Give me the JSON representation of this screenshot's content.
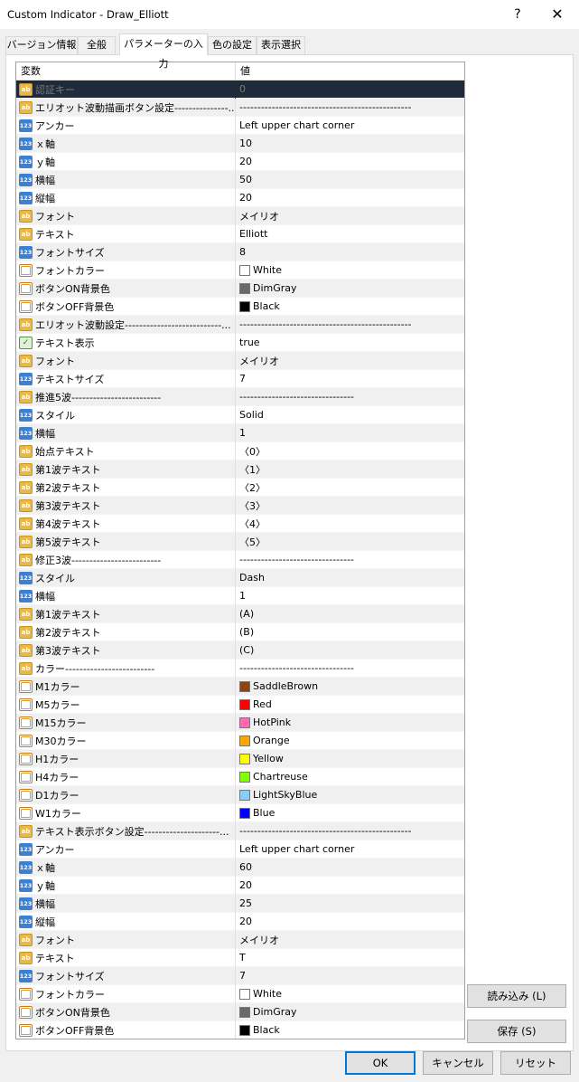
{
  "window": {
    "title": "Custom Indicator - Draw_Elliott",
    "help_label": "?",
    "close_label": "✕"
  },
  "tabs": [
    {
      "label": "バージョン情報"
    },
    {
      "label": "全般"
    },
    {
      "label": "パラメーターの入力"
    },
    {
      "label": "色の設定"
    },
    {
      "label": "表示選択"
    }
  ],
  "grid": {
    "headers": {
      "variable": "変数",
      "value": "値"
    },
    "rows": [
      {
        "icon": "str",
        "name": "認証キー",
        "value": "0"
      },
      {
        "icon": "str",
        "name": "エリオット波動描画ボタン設定---------------...",
        "value": "------------------------------------------------"
      },
      {
        "icon": "int",
        "name": "アンカー",
        "value": "Left upper chart corner"
      },
      {
        "icon": "int",
        "name": "ｘ軸",
        "value": "10"
      },
      {
        "icon": "int",
        "name": "ｙ軸",
        "value": "20"
      },
      {
        "icon": "int",
        "name": "横幅",
        "value": "50"
      },
      {
        "icon": "int",
        "name": "縦幅",
        "value": "20"
      },
      {
        "icon": "str",
        "name": "フォント",
        "value": "メイリオ"
      },
      {
        "icon": "str",
        "name": "テキスト",
        "value": "Elliott"
      },
      {
        "icon": "int",
        "name": "フォントサイズ",
        "value": "8"
      },
      {
        "icon": "color",
        "name": "フォントカラー",
        "value": "White",
        "swatch": "#ffffff"
      },
      {
        "icon": "color",
        "name": "ボタンON背景色",
        "value": "DimGray",
        "swatch": "#696969"
      },
      {
        "icon": "color",
        "name": "ボタンOFF背景色",
        "value": "Black",
        "swatch": "#000000"
      },
      {
        "icon": "str",
        "name": "エリオット波動設定---------------------------...",
        "value": "------------------------------------------------"
      },
      {
        "icon": "bool",
        "name": "テキスト表示",
        "value": "true"
      },
      {
        "icon": "str",
        "name": "フォント",
        "value": "メイリオ"
      },
      {
        "icon": "int",
        "name": "テキストサイズ",
        "value": "7"
      },
      {
        "icon": "str",
        "name": "推進5波-------------------------",
        "value": "--------------------------------"
      },
      {
        "icon": "int",
        "name": "スタイル",
        "value": "Solid"
      },
      {
        "icon": "int",
        "name": "横幅",
        "value": "1"
      },
      {
        "icon": "str",
        "name": "始点テキスト",
        "value": "〈0〉"
      },
      {
        "icon": "str",
        "name": "第1波テキスト",
        "value": "〈1〉"
      },
      {
        "icon": "str",
        "name": "第2波テキスト",
        "value": "〈2〉"
      },
      {
        "icon": "str",
        "name": "第3波テキスト",
        "value": "〈3〉"
      },
      {
        "icon": "str",
        "name": "第4波テキスト",
        "value": "〈4〉"
      },
      {
        "icon": "str",
        "name": "第5波テキスト",
        "value": "〈5〉"
      },
      {
        "icon": "str",
        "name": "修正3波-------------------------",
        "value": "--------------------------------"
      },
      {
        "icon": "int",
        "name": "スタイル",
        "value": "Dash"
      },
      {
        "icon": "int",
        "name": "横幅",
        "value": "1"
      },
      {
        "icon": "str",
        "name": "第1波テキスト",
        "value": "(A)"
      },
      {
        "icon": "str",
        "name": "第2波テキスト",
        "value": "(B)"
      },
      {
        "icon": "str",
        "name": "第3波テキスト",
        "value": "(C)"
      },
      {
        "icon": "str",
        "name": "カラー-------------------------",
        "value": "--------------------------------"
      },
      {
        "icon": "color",
        "name": "M1カラー",
        "value": "SaddleBrown",
        "swatch": "#8b4513"
      },
      {
        "icon": "color",
        "name": "M5カラー",
        "value": "Red",
        "swatch": "#ff0000"
      },
      {
        "icon": "color",
        "name": "M15カラー",
        "value": "HotPink",
        "swatch": "#ff69b4"
      },
      {
        "icon": "color",
        "name": "M30カラー",
        "value": "Orange",
        "swatch": "#ffa500"
      },
      {
        "icon": "color",
        "name": "H1カラー",
        "value": "Yellow",
        "swatch": "#ffff00"
      },
      {
        "icon": "color",
        "name": "H4カラー",
        "value": "Chartreuse",
        "swatch": "#7fff00"
      },
      {
        "icon": "color",
        "name": "D1カラー",
        "value": "LightSkyBlue",
        "swatch": "#87cefa"
      },
      {
        "icon": "color",
        "name": "W1カラー",
        "value": "Blue",
        "swatch": "#0000ff"
      },
      {
        "icon": "str",
        "name": "テキスト表示ボタン設定---------------------...",
        "value": "------------------------------------------------"
      },
      {
        "icon": "int",
        "name": "アンカー",
        "value": "Left upper chart corner"
      },
      {
        "icon": "int",
        "name": "ｘ軸",
        "value": "60"
      },
      {
        "icon": "int",
        "name": "ｙ軸",
        "value": "20"
      },
      {
        "icon": "int",
        "name": "横幅",
        "value": "25"
      },
      {
        "icon": "int",
        "name": "縦幅",
        "value": "20"
      },
      {
        "icon": "str",
        "name": "フォント",
        "value": "メイリオ"
      },
      {
        "icon": "str",
        "name": "テキスト",
        "value": "T"
      },
      {
        "icon": "int",
        "name": "フォントサイズ",
        "value": "7"
      },
      {
        "icon": "color",
        "name": "フォントカラー",
        "value": "White",
        "swatch": "#ffffff"
      },
      {
        "icon": "color",
        "name": "ボタンON背景色",
        "value": "DimGray",
        "swatch": "#696969"
      },
      {
        "icon": "color",
        "name": "ボタンOFF背景色",
        "value": "Black",
        "swatch": "#000000"
      }
    ]
  },
  "icons": {
    "int": "123",
    "str": "ab",
    "bool": "✓"
  },
  "buttons": {
    "load": "読み込み (L)",
    "save": "保存 (S)",
    "ok": "OK",
    "cancel": "キャンセル",
    "reset": "リセット"
  }
}
